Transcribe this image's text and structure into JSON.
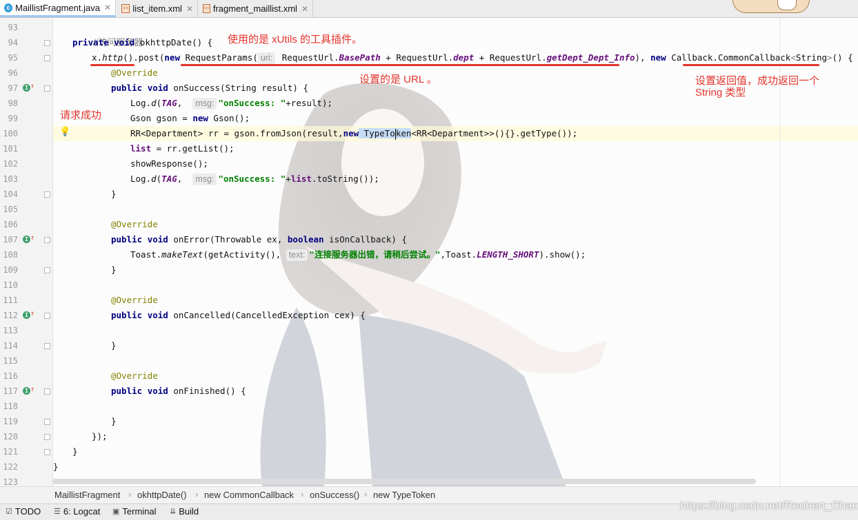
{
  "tabs": [
    {
      "label": "MaillistFragment.java",
      "icon": "java-class-icon",
      "active": true
    },
    {
      "label": "list_item.xml",
      "icon": "xml-file-icon",
      "active": false
    },
    {
      "label": "fragment_maillist.xml",
      "icon": "xml-file-icon",
      "active": false
    }
  ],
  "line_numbers": [
    "93",
    "94",
    "95",
    "96",
    "97",
    "98",
    "99",
    "100",
    "101",
    "102",
    "103",
    "104",
    "105",
    "106",
    "107",
    "108",
    "109",
    "110",
    "111",
    "112",
    "113",
    "114",
    "115",
    "116",
    "117",
    "118",
    "119",
    "120",
    "121",
    "122",
    "123"
  ],
  "code": {
    "l93": "//访问服务器",
    "l94_kw1": "private",
    "l94_kw2": "void",
    "l94_rest": " okhttpDate() {",
    "l95_x": "x",
    "l95_dot": ".",
    "l95_http": "http",
    "l95_paren": "()",
    "l95_post": ".post(",
    "l95_new": "new",
    "l95_rp": " RequestParams(",
    "l95_hint": "uri:",
    "l95_ru1": " RequestUrl.",
    "l95_bp": "BasePath",
    "l95_ru2": " + RequestUrl.",
    "l95_dept": "dept",
    "l95_ru3": " + RequestUrl.",
    "l95_gd": "getDept_Dept_Info",
    "l95_close": "), ",
    "l95_new2": "new",
    "l95_cb": " Callback.CommonCallback",
    "l95_lt": "<",
    "l95_str": "String",
    "l95_gt": ">",
    "l95_end": "() {",
    "l96": "@Override",
    "l97_kw1": "public",
    "l97_kw2": "void",
    "l97_rest": " onSuccess(String result) {",
    "l98_a": "Log.",
    "l98_d": "d",
    "l98_b": "(",
    "l98_tag": "TAG",
    "l98_c": ", ",
    "l98_hint": "msg:",
    "l98_str": "\"onSuccess: \"",
    "l98_end": "+result);",
    "l99_a": "Gson gson = ",
    "l99_new": "new",
    "l99_end": " Gson();",
    "l100_a": "RR<Department> rr = gson.fromJson(result,",
    "l100_new": "new",
    "l100_tt1": " TypeTo",
    "l100_tt2": "ken",
    "l100_end": "<RR<Department>>(){}.getType());",
    "l101_list": "list",
    "l101_end": " = rr.getList();",
    "l102": "showResponse();",
    "l103_a": "Log.",
    "l103_d": "d",
    "l103_b": "(",
    "l103_tag": "TAG",
    "l103_c": ", ",
    "l103_hint": "msg:",
    "l103_str": "\"onSuccess: \"",
    "l103_plus": "+",
    "l103_list": "list",
    "l103_end": ".toString());",
    "l104": "}",
    "l106": "@Override",
    "l107_kw1": "public",
    "l107_kw2": "void",
    "l107_a": " onError(Throwable ex, ",
    "l107_bool": "boolean",
    "l107_end": " isOnCallback) {",
    "l108_a": "Toast.",
    "l108_mt": "makeText",
    "l108_b": "(getActivity(), ",
    "l108_hint": "text:",
    "l108_str": "\"连接服务器出错，请稍后尝试。\"",
    "l108_c": ",Toast.",
    "l108_ls": "LENGTH_SHORT",
    "l108_end": ").show();",
    "l109": "}",
    "l111": "@Override",
    "l112_kw1": "public",
    "l112_kw2": "void",
    "l112_rest": " onCancelled(CancelledException cex) {",
    "l114": "}",
    "l116": "@Override",
    "l117_kw1": "public",
    "l117_kw2": "void",
    "l117_rest": " onFinished() {",
    "l119": "}",
    "l120": "});",
    "l121": "}",
    "l122": "}"
  },
  "annotations": {
    "xutils": "使用的是 xUtils 的工具插件。",
    "url": "设置的是 URL 。",
    "callback_line1": "设置返回值，成功返回一个",
    "callback_line2": "String 类型",
    "success": "请求成功"
  },
  "breadcrumb": [
    "MaillistFragment",
    "okhttpDate()",
    "new CommonCallback",
    "onSuccess()",
    "new TypeToken"
  ],
  "bottom_tools": [
    {
      "label": "TODO",
      "icon": "todo-icon"
    },
    {
      "label": "6: Logcat",
      "icon": "logcat-icon"
    },
    {
      "label": "Terminal",
      "icon": "terminal-icon"
    },
    {
      "label": "Build",
      "icon": "build-icon"
    }
  ],
  "watermark": "https://blog.csdn.net/Roobert_Chao",
  "colors": {
    "annotation_red": "#e3342c",
    "keyword": "#000080",
    "string": "#008000",
    "static_field": "#660e7a"
  }
}
